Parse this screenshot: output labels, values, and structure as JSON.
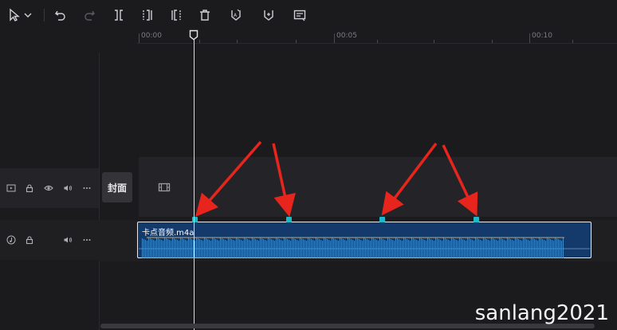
{
  "toolbar": {
    "items": [
      "select-pointer-icon",
      "dropdown-chevron-icon",
      "undo-icon",
      "redo-icon",
      "split-icon",
      "split-left-icon",
      "split-right-icon",
      "delete-icon",
      "auto-beat-icon",
      "manual-beat-icon",
      "caption-icon"
    ]
  },
  "ruler": {
    "labels": [
      "00:00",
      "00:05",
      "00:10"
    ]
  },
  "video_track": {
    "cover_label": "封面"
  },
  "audio_track": {
    "clip_name": "卡点音频.m4a",
    "beat_markers": 4
  },
  "colors": {
    "background": "#1b1b1e",
    "clip": "#133a6a",
    "beat": "#20b8c8",
    "arrow": "#e8251d"
  },
  "watermark": "sanlang2021"
}
